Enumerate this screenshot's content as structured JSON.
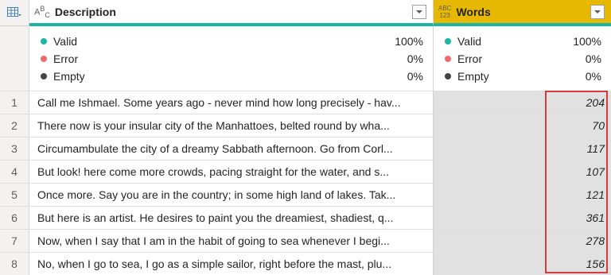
{
  "columns": {
    "desc": {
      "type_icon": "A B C text-type",
      "title": "Description"
    },
    "words": {
      "type_icon": "ABC 123 any-type",
      "title": "Words"
    }
  },
  "quality": {
    "desc": [
      {
        "label": "Valid",
        "value": "100%",
        "color": "#19b5a5"
      },
      {
        "label": "Error",
        "value": "0%",
        "color": "#f06a6a"
      },
      {
        "label": "Empty",
        "value": "0%",
        "color": "#444444"
      }
    ],
    "words": [
      {
        "label": "Valid",
        "value": "100%",
        "color": "#19b5a5"
      },
      {
        "label": "Error",
        "value": "0%",
        "color": "#f06a6a"
      },
      {
        "label": "Empty",
        "value": "0%",
        "color": "#444444"
      }
    ]
  },
  "rows": [
    {
      "idx": "1",
      "desc": "Call me Ishmael. Some years ago - never mind how long precisely - hav...",
      "words": "204"
    },
    {
      "idx": "2",
      "desc": "There now is your insular city of the Manhattoes, belted round by wha...",
      "words": "70"
    },
    {
      "idx": "3",
      "desc": "Circumambulate the city of a dreamy Sabbath afternoon. Go from Corl...",
      "words": "117"
    },
    {
      "idx": "4",
      "desc": "But look! here come more crowds, pacing straight for the water, and s...",
      "words": "107"
    },
    {
      "idx": "5",
      "desc": "Once more. Say you are in the country; in some high land of lakes. Tak...",
      "words": "121"
    },
    {
      "idx": "6",
      "desc": "But here is an artist. He desires to paint you the dreamiest, shadiest, q...",
      "words": "361"
    },
    {
      "idx": "7",
      "desc": "Now, when I say that I am in the habit of going to sea whenever I begi...",
      "words": "278"
    },
    {
      "idx": "8",
      "desc": "No, when I go to sea, I go as a simple sailor, right before the mast, plu...",
      "words": "156"
    }
  ]
}
